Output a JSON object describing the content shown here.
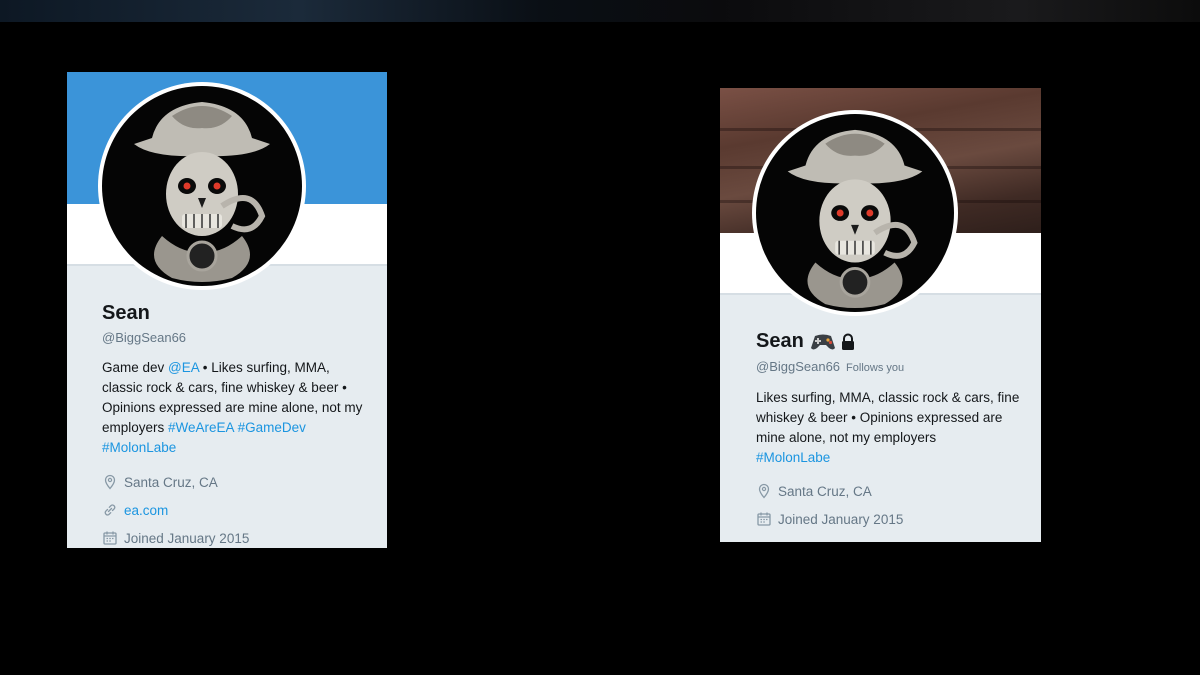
{
  "left_profile": {
    "name": "Sean",
    "handle": "@BiggSean66",
    "bio": {
      "t1": "Game dev ",
      "mention": "@EA",
      "t2": " • Likes surfing, MMA, classic rock & cars, fine whiskey & beer • Opinions expressed are mine alone, not my employers ",
      "tag1": "#WeAreEA",
      "tag2": "#GameDev",
      "tag3": "#MolonLabe"
    },
    "location": "Santa Cruz, CA",
    "website": "ea.com",
    "joined": "Joined January 2015",
    "banner_color": "#3b94d9"
  },
  "right_profile": {
    "name": "Sean",
    "handle": "@BiggSean66",
    "follows_you": "Follows you",
    "bio": {
      "t1": "Likes surfing, MMA, classic rock & cars, fine whiskey & beer • Opinions expressed are mine alone, not my employers ",
      "tag1": "#MolonLabe"
    },
    "location": "Santa Cruz, CA",
    "joined": "Joined January 2015",
    "badges": [
      "gamepad-icon",
      "lock-icon"
    ]
  },
  "colors": {
    "link": "#1b95e0",
    "card_bg": "#e6ecf0",
    "muted": "#657786"
  }
}
